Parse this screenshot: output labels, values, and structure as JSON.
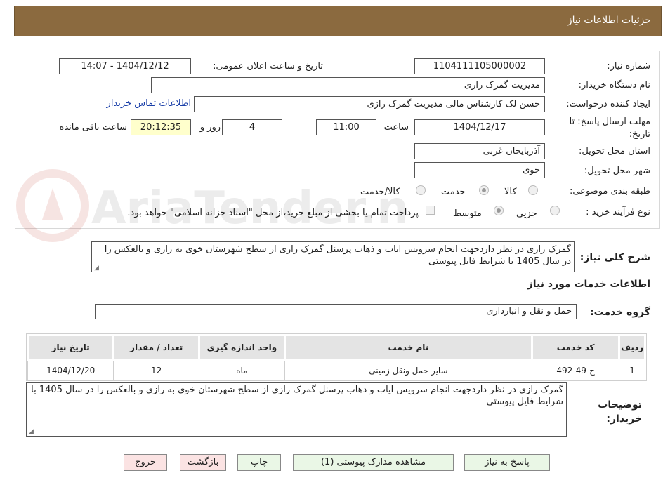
{
  "header": {
    "title": "جزئیات اطلاعات نیاز"
  },
  "form": {
    "need_number_label": "شماره نیاز:",
    "need_number": "1104111105000002",
    "announce_label": "تاریخ و ساعت اعلان عمومی:",
    "announce_value": "1404/12/12 - 14:07",
    "buyer_org_label": "نام دستگاه خریدار:",
    "buyer_org": "مدیریت گمرک رازی",
    "creator_label": "ایجاد کننده درخواست:",
    "creator": "حسن لک کارشناس مالی مدیریت گمرک رازی",
    "contact_link": "اطلاعات تماس خریدار",
    "deadline_label": "مهلت ارسال پاسخ: تا تاریخ:",
    "deadline_date": "1404/12/17",
    "time_label": "ساعت",
    "deadline_time": "11:00",
    "days_value": "4",
    "days_label": "روز و",
    "remaining_time": "20:12:35",
    "remaining_label": "ساعت باقی مانده",
    "province_label": "استان محل تحویل:",
    "province": "آذربایجان غربی",
    "city_label": "شهر محل تحویل:",
    "city": "خوی",
    "category_label": "طبقه بندی موضوعی:",
    "category_options": [
      "کالا",
      "خدمت",
      "کالا/خدمت"
    ],
    "category_selected": "خدمت",
    "process_label": "نوع فرآیند خرید :",
    "process_options": [
      "جزیی",
      "متوسط"
    ],
    "process_selected": "متوسط",
    "payment_note": "پرداخت تمام یا بخشی از مبلغ خرید،از محل \"اسناد خزانه اسلامی\" خواهد بود."
  },
  "description": {
    "label": "شرح کلی نیاز:",
    "text": "گمرک رازی در نظر داردجهت انجام سرویس ایاب و ذهاب پرسنل گمرک رازی از سطح شهرستان خوی به رازی و بالعکس را در سال 1405 با شرایط فایل پیوستی"
  },
  "services": {
    "title": "اطلاعات خدمات مورد نیاز",
    "group_label": "گروه خدمت:",
    "group_value": "حمل و نقل و انبارداری",
    "table": {
      "headers": [
        "ردیف",
        "کد خدمت",
        "نام خدمت",
        "واحد اندازه گیری",
        "تعداد / مقدار",
        "تاریخ نیاز"
      ],
      "rows": [
        [
          "1",
          "ح-49-492",
          "سایر حمل ونقل زمینی",
          "ماه",
          "12",
          "1404/12/20"
        ]
      ]
    }
  },
  "buyer_notes": {
    "label": "توضیحات خریدار:",
    "text": "گمرک رازی در نظر داردجهت انجام سرویس ایاب و ذهاب پرسنل گمرک رازی از سطح شهرستان خوی به رازی و بالعکس را در سال 1405 با شرایط فایل پیوستی"
  },
  "buttons": {
    "reply": "پاسخ به نیاز",
    "attachments": "مشاهده مدارک پیوستی (1)",
    "print": "چاپ",
    "back": "بازگشت",
    "exit": "خروج"
  },
  "colors": {
    "header_bg": "#8b6a3f",
    "button_green": "#eaf7e6",
    "button_pink": "#fbe3e3",
    "highlight_yellow": "#ffffcc",
    "link_blue": "#1a3fa8"
  },
  "watermark": {
    "logo_text": "AriaTender.neT"
  }
}
